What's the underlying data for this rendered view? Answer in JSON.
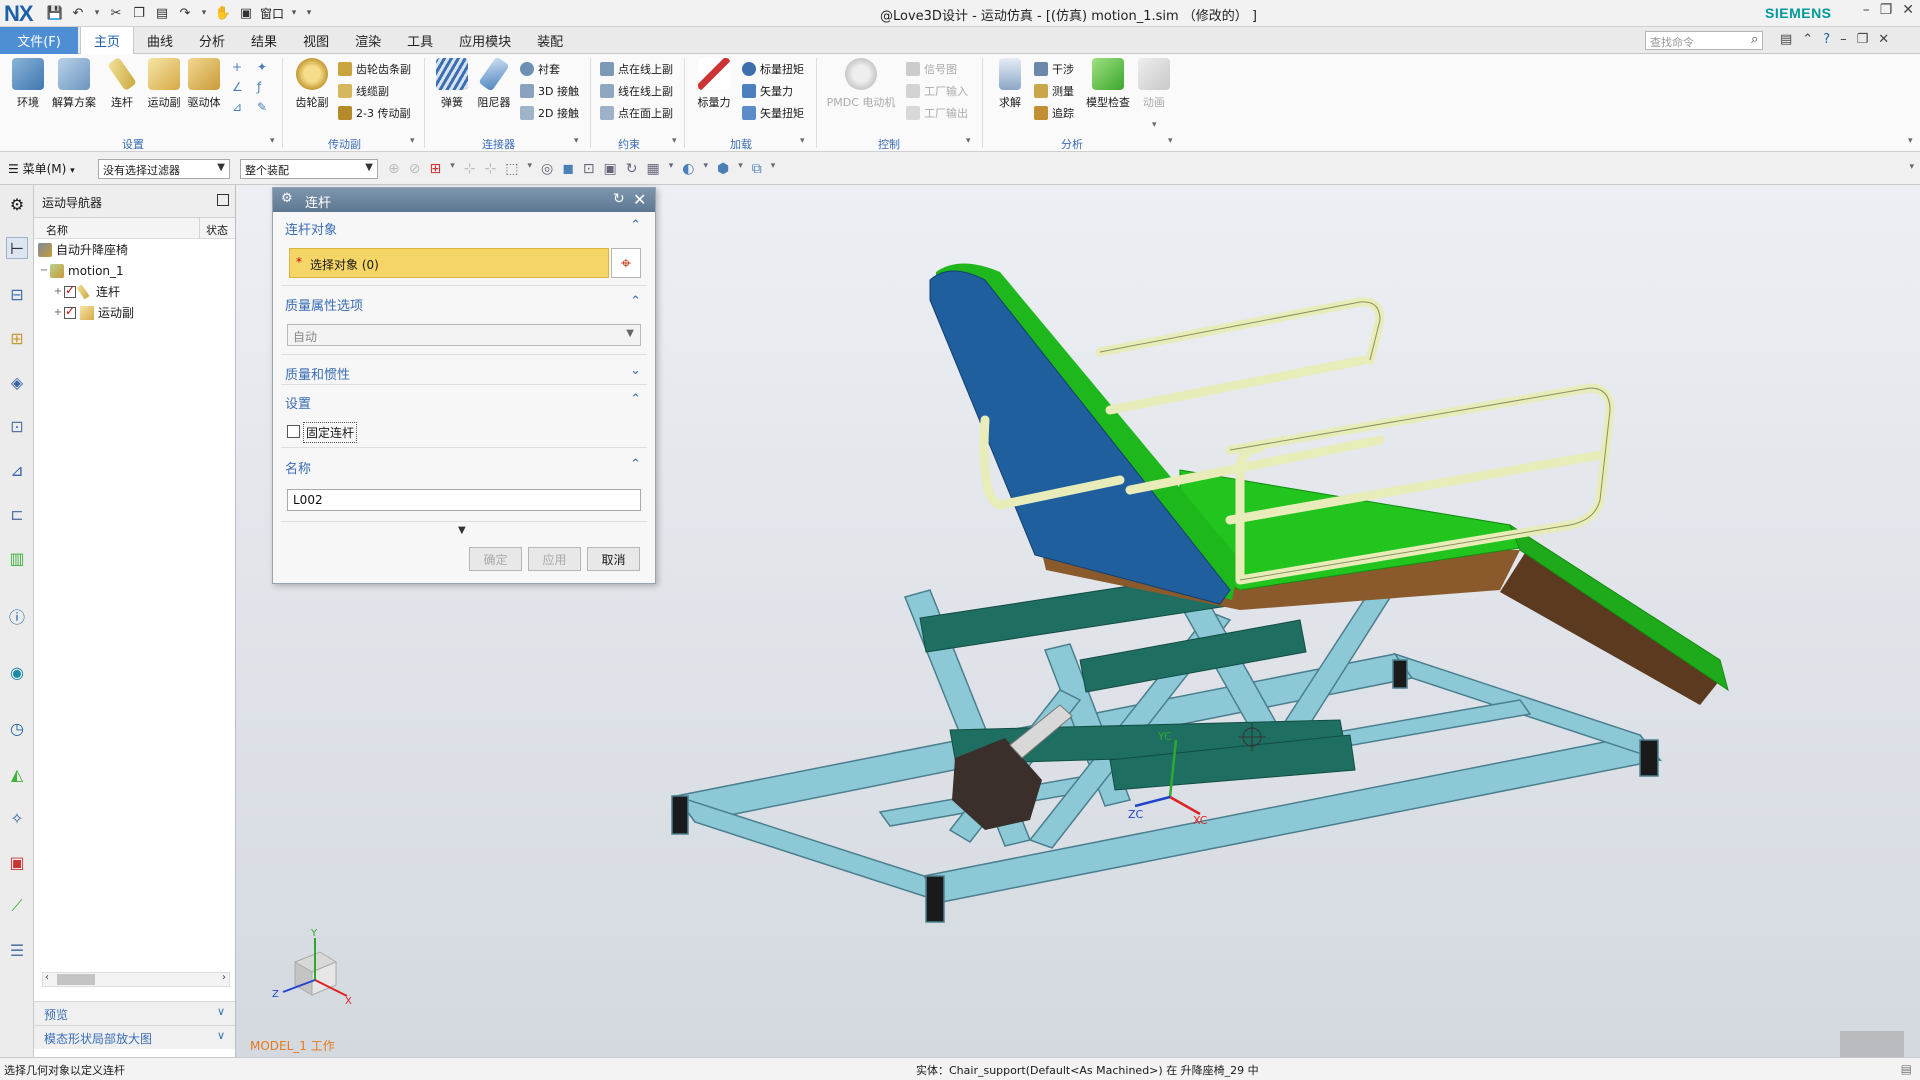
{
  "app": {
    "logo": "NX",
    "window_title": "@Love3D设计 - 运动仿真 - [(仿真) motion_1.sim （修改的） ]",
    "brand": "SIEMENS",
    "window_menu": "窗口"
  },
  "menu": {
    "file": "文件(F)",
    "tabs": [
      "主页",
      "曲线",
      "分析",
      "结果",
      "视图",
      "渲染",
      "工具",
      "应用模块",
      "装配"
    ],
    "search_placeholder": "查找命令"
  },
  "ribbon": {
    "big_buttons": [
      {
        "label": "环境"
      },
      {
        "label": "解算方案"
      },
      {
        "label": "连杆"
      },
      {
        "label": "运动副"
      },
      {
        "label": "驱动体"
      },
      {
        "label": "齿轮副"
      },
      {
        "label": "弹簧"
      },
      {
        "label": "阻尼器"
      },
      {
        "label": "标量力"
      },
      {
        "label": "PMDC 电动机"
      },
      {
        "label": "求解"
      },
      {
        "label": "模型检查"
      },
      {
        "label": "动画"
      }
    ],
    "small_buttons": [
      {
        "label": "齿轮齿条副"
      },
      {
        "label": "线缆副"
      },
      {
        "label": "2-3 传动副"
      },
      {
        "label": "衬套"
      },
      {
        "label": "3D 接触"
      },
      {
        "label": "2D 接触"
      },
      {
        "label": "点在线上副"
      },
      {
        "label": "线在线上副"
      },
      {
        "label": "点在面上副"
      },
      {
        "label": "标量扭矩"
      },
      {
        "label": "矢量力"
      },
      {
        "label": "矢量扭矩"
      },
      {
        "label": "信号图"
      },
      {
        "label": "工厂输入"
      },
      {
        "label": "工厂输出"
      },
      {
        "label": "干涉"
      },
      {
        "label": "测量"
      },
      {
        "label": "追踪"
      }
    ],
    "groups": [
      "设置",
      "传动副",
      "连接器",
      "约束",
      "加载",
      "控制",
      "分析"
    ]
  },
  "toolbar2": {
    "menu": "菜单(M)",
    "filter": "没有选择过滤器",
    "assembly": "整个装配"
  },
  "navigator": {
    "title": "运动导航器",
    "col_name": "名称",
    "col_status": "状态",
    "tree": [
      {
        "label": "自动升降座椅",
        "level": 0
      },
      {
        "label": "motion_1",
        "level": 1
      },
      {
        "label": "连杆",
        "level": 2
      },
      {
        "label": "运动副",
        "level": 2
      }
    ],
    "panels": [
      "预览",
      "模态形状局部放大图"
    ]
  },
  "dialog": {
    "title": "连杆",
    "sections": {
      "link_object": "连杆对象",
      "select_object": "选择对象 (0)",
      "mass_options": "质量属性选项",
      "mass_value": "自动",
      "mass_inertia": "质量和惯性",
      "settings": "设置",
      "fixed_link": "固定连杆",
      "name": "名称",
      "name_value": "L002"
    },
    "buttons": {
      "ok": "确定",
      "apply": "应用",
      "cancel": "取消"
    }
  },
  "viewport": {
    "model_label": "MODEL_1 工作",
    "axes": {
      "x": "XC",
      "y": "YC",
      "z": "ZC",
      "triad_x": "X",
      "triad_y": "Y",
      "triad_z": "Z"
    }
  },
  "status": {
    "left": "选择几何对象以定义连杆",
    "right": "实体：Chair_support(Default<As Machined>) 在 升降座椅_29 中"
  },
  "colors": {
    "accent": "#4d8ed4",
    "dialog_header": "#6c859d",
    "selection": "#f5d565",
    "seat_green": "#22c41e",
    "frame_blue": "#8cc8d6",
    "back_blue": "#1f5f9e",
    "rail": "#e8ecb8"
  }
}
